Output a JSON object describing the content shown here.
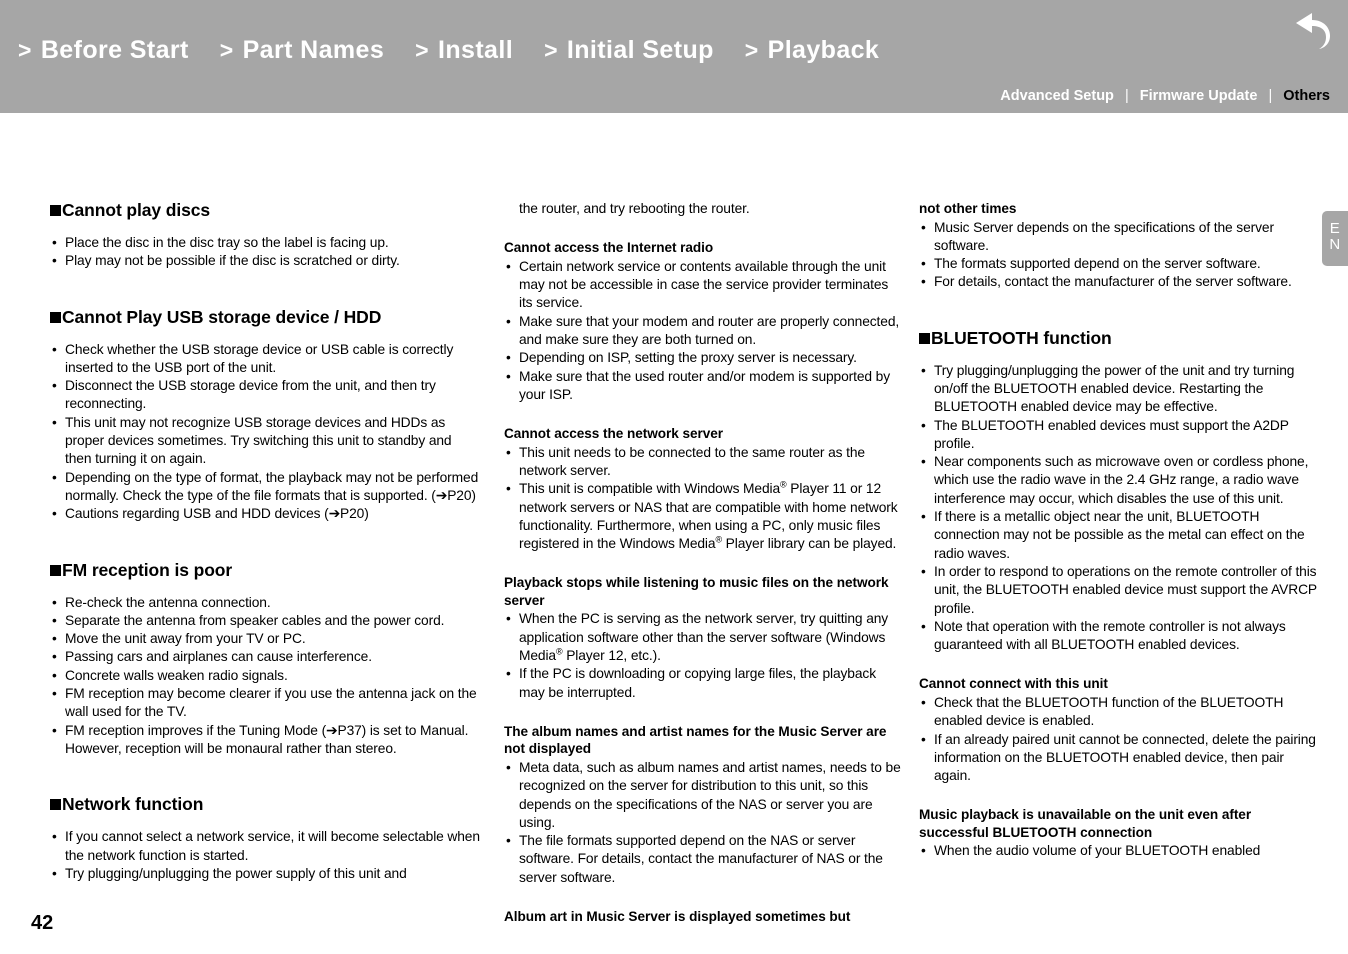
{
  "header": {
    "nav_items": [
      {
        "chevron": ">",
        "label": "Before Start"
      },
      {
        "chevron": ">",
        "label": "Part Names"
      },
      {
        "chevron": ">",
        "label": "Install"
      },
      {
        "chevron": ">",
        "label": "Initial Setup"
      },
      {
        "chevron": ">",
        "label": "Playback"
      }
    ],
    "back_icon": "back-arrow-icon",
    "sub_nav": [
      {
        "label": "Advanced Setup",
        "current": false
      },
      {
        "label": "Firmware Update",
        "current": false
      },
      {
        "label": "Others",
        "current": true
      }
    ],
    "separator": "|",
    "bg_color": "#a6a6a6"
  },
  "lang_tab": {
    "line1": "E",
    "line2": "N"
  },
  "page_number": "42",
  "columns": {
    "col1": {
      "sections": [
        {
          "heading": "Cannot play discs",
          "bullets": [
            "Place the disc in the disc tray so the label is facing up.",
            "Play may not be possible if the disc is scratched or dirty."
          ]
        },
        {
          "heading": "Cannot Play USB storage device / HDD",
          "bullets": [
            "Check whether the USB storage device or USB cable is correctly inserted to the USB port of the unit.",
            "Disconnect the USB storage device from the unit, and then try reconnecting.",
            "This unit may not recognize USB storage devices and HDDs as proper devices sometimes. Try switching this unit to standby and then turning it on again.",
            "Depending on the type of format, the playback may not be performed normally. Check the type of the file formats that is supported. (➔P20)",
            "Cautions regarding USB and HDD devices (➔P20)"
          ]
        },
        {
          "heading": "FM reception is poor",
          "bullets": [
            "Re-check the antenna connection.",
            "Separate the antenna from speaker cables and the power cord.",
            "Move the unit away from your TV or PC.",
            "Passing cars and airplanes can cause interference.",
            "Concrete walls weaken radio signals.",
            "FM reception may become clearer if you use the antenna jack on the wall used for the TV.",
            "FM reception improves if the Tuning Mode (➔P37) is set to Manual. However, reception will be monaural rather than stereo."
          ]
        },
        {
          "heading": "Network function",
          "bullets": [
            "If you cannot select a network service, it will become selectable when the network function is started.",
            "Try plugging/unplugging the power supply of this unit and"
          ]
        }
      ]
    },
    "col2": {
      "continuation": "the router, and try rebooting the router.",
      "sections": [
        {
          "heading": "Cannot access the Internet radio",
          "bullets": [
            "Certain network service or contents available through the unit may not be accessible in case the service provider terminates its service.",
            "Make sure that your modem and router are properly connected, and make sure they are both turned on.",
            "Depending on ISP, setting the proxy server is necessary.",
            "Make sure that the used router and/or modem is supported by your ISP."
          ]
        },
        {
          "heading": "Cannot access the network server",
          "bullets_html": [
            "This unit needs to be connected to the same router as the network server.",
            "This unit is compatible with Windows Media<sup>®</sup> Player 11 or 12 network servers or NAS that are compatible with home network functionality. Furthermore, when using a PC, only music files registered in the Windows Media<sup>®</sup> Player library can be played."
          ]
        },
        {
          "heading": "Playback stops while listening to music files on the network server",
          "bullets_html": [
            "When the PC is serving as the network server, try quitting any application software other than the server software (Windows Media<sup>®</sup> Player 12, etc.).",
            "If the PC is downloading or copying large files, the playback may be interrupted."
          ]
        },
        {
          "heading": "The album names and artist names for the Music Server are not displayed",
          "bullets": [
            "Meta data, such as album names and artist names, needs to be recognized on the server for distribution to this unit, so this depends on the specifications of the NAS or server you are using.",
            "The file formats supported depend on the NAS or server software. For details, contact the manufacturer of NAS or the server software."
          ]
        },
        {
          "heading": "Album art in Music Server is displayed sometimes but",
          "bullets": []
        }
      ]
    },
    "col3": {
      "continuation_heading": "not other times",
      "continuation_bullets": [
        "Music Server depends on the specifications of the server software.",
        "The formats supported depend on the server software.",
        "For details, contact the manufacturer of the server software."
      ],
      "sections": [
        {
          "heading": "BLUETOOTH function",
          "bullets": [
            "Try plugging/unplugging the power of the unit and try turning on/off the BLUETOOTH enabled device. Restarting the BLUETOOTH enabled device may be effective.",
            "The BLUETOOTH enabled devices must support the A2DP profile.",
            "Near components such as microwave oven or cordless phone, which use the radio wave in the 2.4 GHz range, a radio wave interference may occur, which disables the use of this unit.",
            "If there is a metallic object near the unit, BLUETOOTH connection may not be possible as the metal can effect on the radio waves.",
            "In order to respond to operations on the remote controller of this unit, the BLUETOOTH enabled device must support the AVRCP profile.",
            "Note that operation with the remote controller is not always guaranteed with all BLUETOOTH enabled devices."
          ]
        }
      ],
      "sub_sections": [
        {
          "heading": "Cannot connect with this unit",
          "bullets": [
            "Check that the BLUETOOTH function of the BLUETOOTH enabled device is enabled.",
            "If an already paired unit cannot be connected, delete the pairing information on the BLUETOOTH enabled device, then pair again."
          ]
        },
        {
          "heading": "Music playback is unavailable on the unit even after successful BLUETOOTH connection",
          "bullets": [
            "When the audio volume of your BLUETOOTH enabled"
          ]
        }
      ]
    }
  }
}
